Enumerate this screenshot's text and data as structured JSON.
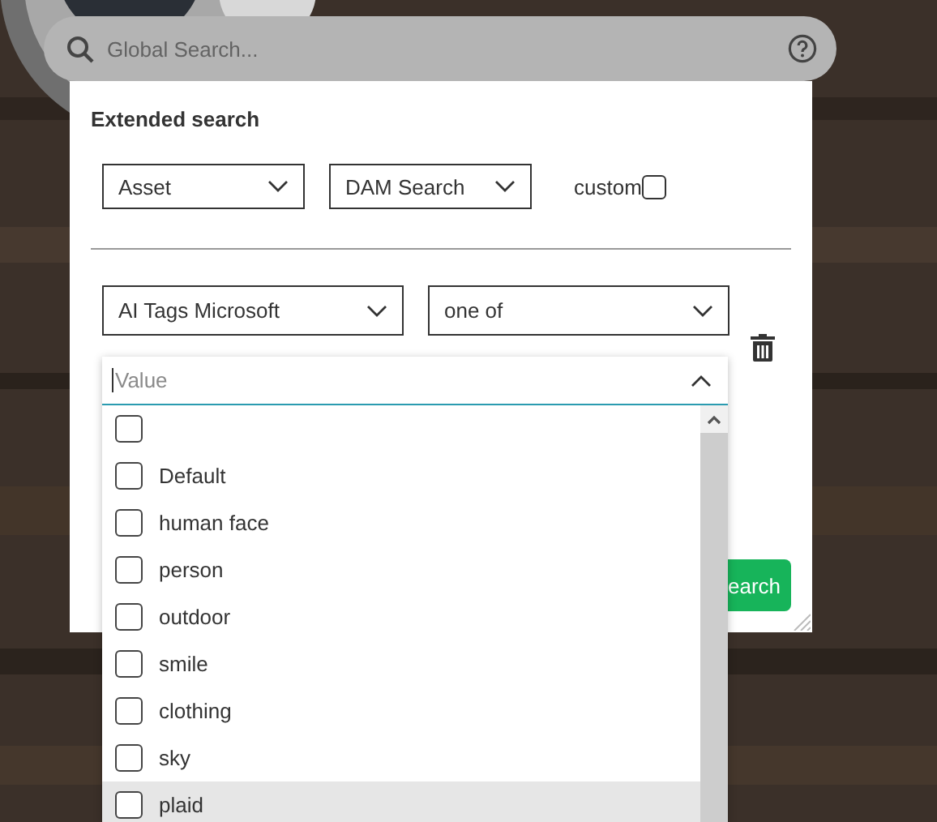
{
  "search_bar": {
    "placeholder": "Global Search..."
  },
  "panel": {
    "title": "Extended search",
    "filters": [
      {
        "value": "Asset"
      },
      {
        "value": "DAM Search"
      }
    ],
    "custom": {
      "label": "custom",
      "checked": false
    },
    "condition": {
      "field": "AI Tags Microsoft",
      "operator": "one of"
    },
    "value_field": {
      "placeholder": "Value",
      "expanded": true
    },
    "options": [
      {
        "checked": false,
        "highlighted": false
      },
      {
        "label": "Default",
        "checked": false,
        "highlighted": false
      },
      {
        "label": "human face",
        "checked": false,
        "highlighted": false
      },
      {
        "label": "person",
        "checked": false,
        "highlighted": false
      },
      {
        "label": "outdoor",
        "checked": false,
        "highlighted": false
      },
      {
        "label": "smile",
        "checked": false,
        "highlighted": false
      },
      {
        "label": "clothing",
        "checked": false,
        "highlighted": false
      },
      {
        "label": "sky",
        "checked": false,
        "highlighted": false
      },
      {
        "label": "plaid",
        "checked": false,
        "highlighted": true
      }
    ],
    "search_button": "earch"
  }
}
